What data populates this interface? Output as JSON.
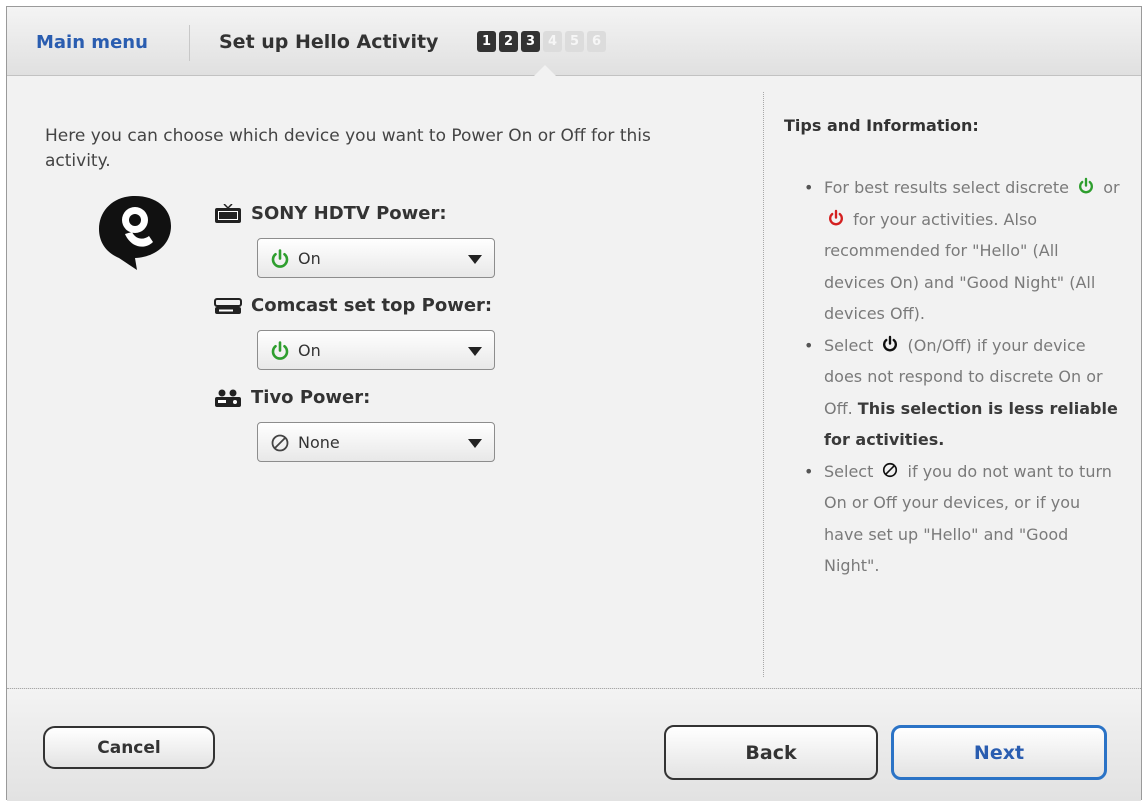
{
  "header": {
    "main_menu": "Main menu",
    "title": "Set up Hello Activity",
    "steps": [
      "1",
      "2",
      "3",
      "4",
      "5",
      "6"
    ],
    "current_step": 3
  },
  "main": {
    "intro": "Here you can choose which device you want to Power On or Off for this activity.",
    "devices": [
      {
        "label": "SONY HDTV Power:",
        "icon": "tv-icon",
        "selected": "On",
        "selected_icon": "power-on-icon"
      },
      {
        "label": "Comcast set top Power:",
        "icon": "set-top-box-icon",
        "selected": "On",
        "selected_icon": "power-on-icon"
      },
      {
        "label": "Tivo Power:",
        "icon": "tivo-icon",
        "selected": "None",
        "selected_icon": "none-icon"
      }
    ]
  },
  "tips": {
    "title": "Tips and Information:",
    "item1_a": "For best results select discrete",
    "item1_or": "or",
    "item1_b": "for your activities. Also recommended for \"Hello\" (All devices On) and \"Good Night\" (All devices Off).",
    "item2_a": "Select",
    "item2_b": "(On/Off) if your device does not respond to discrete On or Off.",
    "item2_bold": "This selection is less reliable for activities.",
    "item3_a": "Select",
    "item3_b": "if you do not want to turn On or Off your devices, or if you have set up \"Hello\" and \"Good Night\"."
  },
  "footer": {
    "cancel": "Cancel",
    "back": "Back",
    "next": "Next"
  },
  "colors": {
    "link_blue": "#2a5db0",
    "power_on_green": "#2e9e2e",
    "power_off_red": "#d42020",
    "next_border": "#2b73c6"
  }
}
